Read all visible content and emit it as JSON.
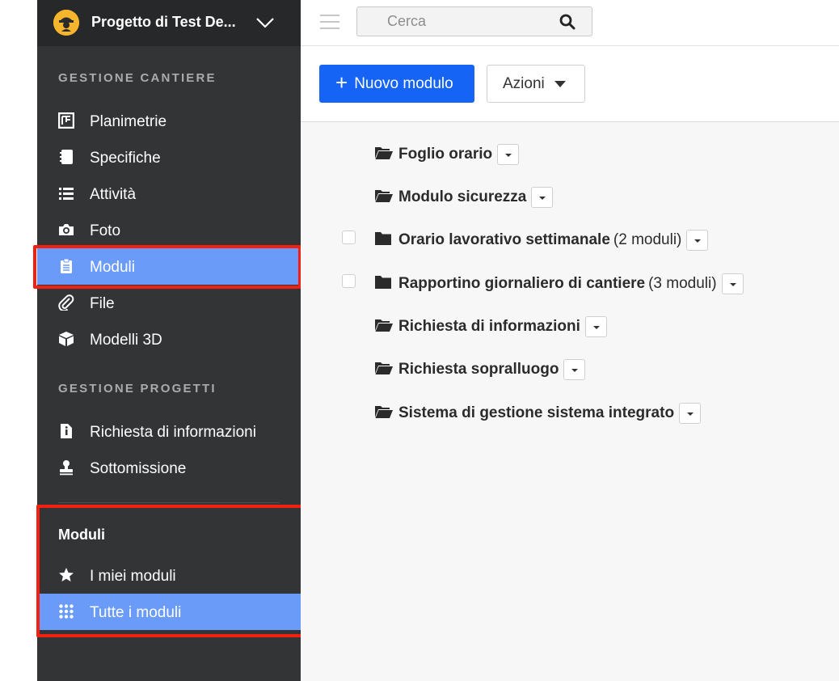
{
  "sidebar": {
    "project_name": "Progetto di Test De...",
    "section_cantiere": "GESTIONE CANTIERE",
    "cantiere_items": [
      {
        "label": "Planimetrie",
        "icon": "floorplan-icon"
      },
      {
        "label": "Specifiche",
        "icon": "book-icon"
      },
      {
        "label": "Attività",
        "icon": "list-icon"
      },
      {
        "label": "Foto",
        "icon": "camera-icon"
      },
      {
        "label": "Moduli",
        "icon": "clipboard-icon",
        "active": true
      },
      {
        "label": "File",
        "icon": "paperclip-icon"
      },
      {
        "label": "Modelli 3D",
        "icon": "cube-icon"
      }
    ],
    "section_progetti": "GESTIONE PROGETTI",
    "progetti_items": [
      {
        "label": "Richiesta di informazioni",
        "icon": "info-file-icon"
      },
      {
        "label": "Sottomissione",
        "icon": "stamp-icon"
      }
    ],
    "sub_title": "Moduli",
    "sub_items": [
      {
        "label": "I miei moduli",
        "icon": "star-icon"
      },
      {
        "label": "Tutte i moduli",
        "icon": "grid-icon",
        "active": true
      }
    ]
  },
  "topbar": {
    "search_placeholder": "Cerca"
  },
  "toolbar": {
    "new_label": "Nuovo modulo",
    "actions_label": "Azioni"
  },
  "folders": [
    {
      "name": "Foglio orario",
      "count": "",
      "checkbox": false,
      "open": true
    },
    {
      "name": "Modulo sicurezza",
      "count": "",
      "checkbox": false,
      "open": true
    },
    {
      "name": "Orario lavorativo settimanale",
      "count": "(2 moduli)",
      "checkbox": true,
      "open": false
    },
    {
      "name": "Rapportino giornaliero di cantiere",
      "count": "(3 moduli)",
      "checkbox": true,
      "open": false
    },
    {
      "name": "Richiesta di informazioni",
      "count": "",
      "checkbox": false,
      "open": true
    },
    {
      "name": "Richiesta sopralluogo",
      "count": "",
      "checkbox": false,
      "open": true
    },
    {
      "name": "Sistema di gestione sistema integrato",
      "count": "",
      "checkbox": false,
      "open": true
    }
  ],
  "colors": {
    "sidebar_bg": "#333436",
    "active_bg": "#6a9bf8",
    "primary": "#1664f5",
    "highlight": "#f31f10"
  }
}
